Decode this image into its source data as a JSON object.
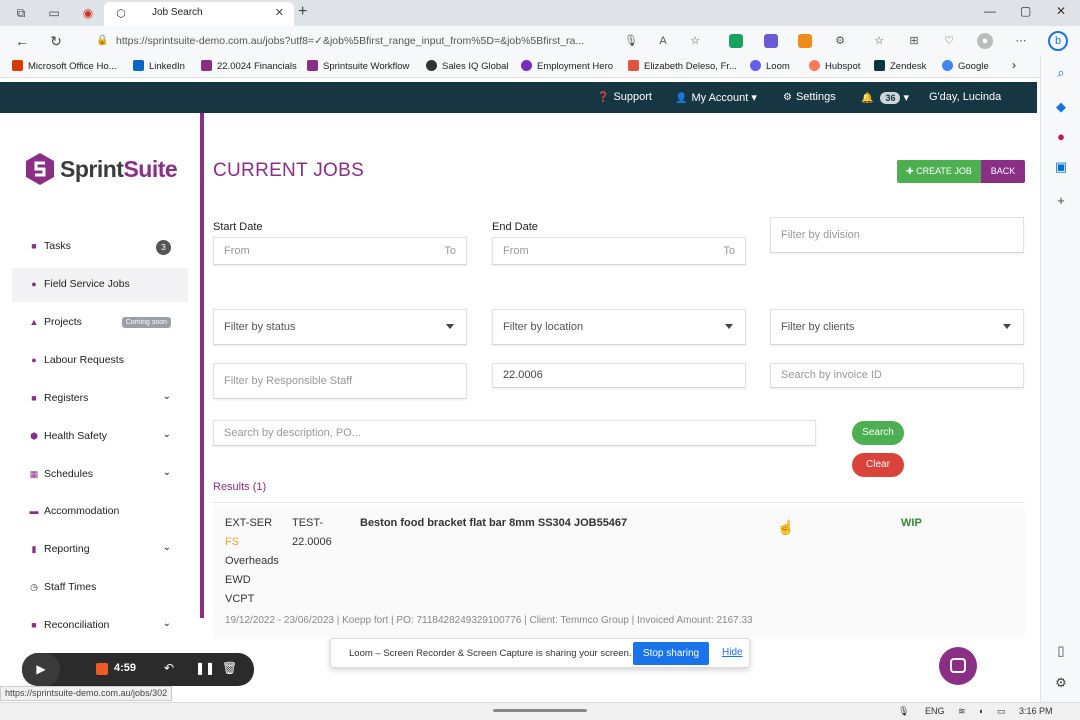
{
  "browser": {
    "tab_title": "Job Search",
    "url": "https://sprintsuite-demo.com.au/jobs?utf8=✓&job%5Bfirst_range_input_from%5D=&job%5Bfirst_ra...",
    "bookmarks": [
      {
        "label": "Microsoft Office Ho...",
        "icon": "office-icon",
        "color": "#d83b01"
      },
      {
        "label": "LinkedIn",
        "icon": "linkedin-icon",
        "color": "#0a66c2"
      },
      {
        "label": "22.0024 Financials",
        "icon": "sprintsuite-icon",
        "color": "#8a2e86"
      },
      {
        "label": "Sprintsuite Workflow",
        "icon": "sprintsuite-icon",
        "color": "#8a2e86"
      },
      {
        "label": "Sales IQ Global",
        "icon": "salesiq-icon",
        "color": "#333333"
      },
      {
        "label": "Employment Hero",
        "icon": "employmenthero-icon",
        "color": "#7b2cbf"
      },
      {
        "label": "Elizabeth Deleso, Fr...",
        "icon": "page-icon",
        "color": "#e0533c"
      },
      {
        "label": "Loom",
        "icon": "loom-icon",
        "color": "#625df5"
      },
      {
        "label": "Hubspot",
        "icon": "hubspot-icon",
        "color": "#ff7a59"
      },
      {
        "label": "Zendesk",
        "icon": "zendesk-icon",
        "color": "#03363d"
      },
      {
        "label": "Google",
        "icon": "google-icon",
        "color": "#4285f4"
      }
    ]
  },
  "header": {
    "support": "Support",
    "account": "My Account",
    "settings": "Settings",
    "notification_count": "36",
    "greeting": "G'day, Lucinda"
  },
  "brand": {
    "name_a": "Sprint",
    "name_b": "Suite",
    "color": "#8a2e86"
  },
  "sidebar": {
    "items": [
      {
        "label": "Tasks",
        "badge": "3"
      },
      {
        "label": "Field Service Jobs"
      },
      {
        "label": "Projects",
        "tag": "Coming soon"
      },
      {
        "label": "Labour Requests"
      },
      {
        "label": "Registers"
      },
      {
        "label": "Health Safety"
      },
      {
        "label": "Schedules"
      },
      {
        "label": "Accommodation"
      },
      {
        "label": "Reporting"
      },
      {
        "label": "Staff Times"
      },
      {
        "label": "Reconciliation"
      }
    ]
  },
  "main": {
    "title": "CURRENT JOBS",
    "create_button": "CREATE JOB",
    "back_button": "BACK",
    "start_date_label": "Start Date",
    "end_date_label": "End Date",
    "from_placeholder": "From",
    "to_placeholder": "To",
    "filter_division": "Filter by division",
    "filter_status": "Filter by status",
    "filter_location": "Filter by location",
    "filter_clients": "Filter by clients",
    "filter_staff": "Filter by Responsible Staff",
    "job_number_value": "22.0006",
    "invoice_placeholder": "Search by invoice ID",
    "description_placeholder": "Search by description, PO...",
    "search_button": "Search",
    "clear_button": "Clear",
    "results_label": "Results (1)"
  },
  "job": {
    "tags": [
      "EXT-SER",
      "FS",
      "Overheads",
      "EWD",
      "VCPT"
    ],
    "code_a": "TEST-",
    "code_b": "22.0006",
    "title": "Beston food bracket flat bar 8mm SS304 JOB55467",
    "status": "WIP",
    "meta": "19/12/2022 - 23/06/2023 | Koepp fort | PO: 7118428249329100776 | Client: Temmco Group | Invoiced Amount: 2167.33"
  },
  "recorder": {
    "time": "4:59"
  },
  "status_url": "https://sprintsuite-demo.com.au/jobs/302",
  "loom": {
    "message": "Loom – Screen Recorder & Screen Capture is sharing your screen.",
    "stop": "Stop sharing",
    "hide": "Hide"
  },
  "taskbar": {
    "lang": "ENG",
    "time": "3:16 PM"
  }
}
